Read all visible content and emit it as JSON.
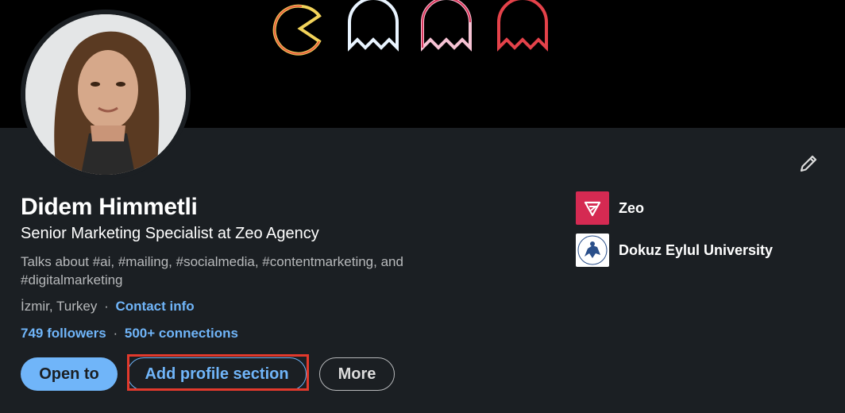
{
  "profile": {
    "name": "Didem Himmetli",
    "headline": "Senior Marketing Specialist at Zeo Agency",
    "about": "Talks about #ai, #mailing, #socialmedia, #contentmarketing, and #digitalmarketing",
    "location": "İzmir, Turkey",
    "separator": "·",
    "contact_info": "Contact info",
    "followers": "749 followers",
    "stats_separator": "·",
    "connections": "500+ connections"
  },
  "actions": {
    "open_to": "Open to",
    "add_profile_section": "Add profile section",
    "more": "More"
  },
  "organizations": [
    {
      "name": "Zeo",
      "logo_color": "#d52a52"
    },
    {
      "name": "Dokuz Eylul University",
      "logo_color": "#ffffff"
    }
  ],
  "colors": {
    "background": "#1b1f23",
    "link": "#70b5f9",
    "highlight_box": "#e2392c"
  },
  "icons": {
    "edit": "pencil-icon",
    "banner": "pacman-ghosts-neon"
  }
}
